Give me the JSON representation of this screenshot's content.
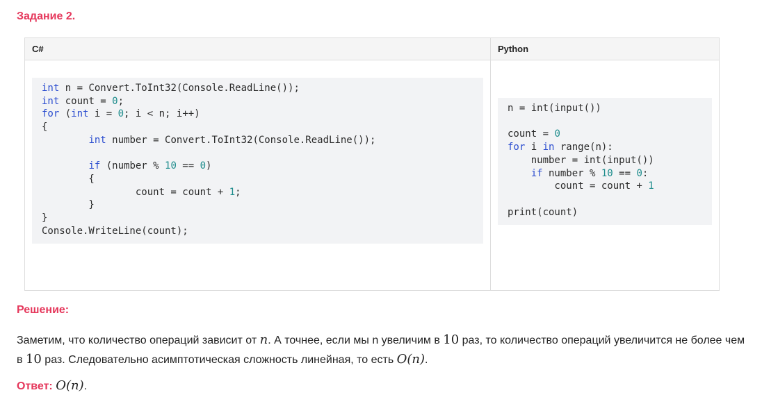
{
  "task_title": "Задание 2.",
  "table": {
    "headers": [
      "C#",
      "Python"
    ],
    "cs_lines": [
      [
        [
          "kw",
          "int"
        ],
        [
          "t",
          " n = Convert.ToInt32(Console.ReadLine());"
        ]
      ],
      [
        [
          "kw",
          "int"
        ],
        [
          "t",
          " count = "
        ],
        [
          "num",
          "0"
        ],
        [
          "t",
          ";"
        ]
      ],
      [
        [
          "kw",
          "for"
        ],
        [
          "t",
          " ("
        ],
        [
          "kw",
          "int"
        ],
        [
          "t",
          " i = "
        ],
        [
          "num",
          "0"
        ],
        [
          "t",
          "; i < n; i++)"
        ]
      ],
      [
        [
          "t",
          "{"
        ]
      ],
      [
        [
          "t",
          "        "
        ],
        [
          "kw",
          "int"
        ],
        [
          "t",
          " number = Convert.ToInt32(Console.ReadLine());"
        ]
      ],
      [
        [
          "t",
          ""
        ]
      ],
      [
        [
          "t",
          "        "
        ],
        [
          "kw",
          "if"
        ],
        [
          "t",
          " (number % "
        ],
        [
          "num",
          "10"
        ],
        [
          "t",
          " == "
        ],
        [
          "num",
          "0"
        ],
        [
          "t",
          ")"
        ]
      ],
      [
        [
          "t",
          "        {"
        ]
      ],
      [
        [
          "t",
          "                count = count + "
        ],
        [
          "num",
          "1"
        ],
        [
          "t",
          ";"
        ]
      ],
      [
        [
          "t",
          "        }"
        ]
      ],
      [
        [
          "t",
          "}"
        ]
      ],
      [
        [
          "t",
          "Console.WriteLine(count);"
        ]
      ]
    ],
    "py_lines": [
      [
        [
          "t",
          "n = int(input())"
        ]
      ],
      [
        [
          "t",
          ""
        ]
      ],
      [
        [
          "t",
          "count = "
        ],
        [
          "num",
          "0"
        ]
      ],
      [
        [
          "kw",
          "for"
        ],
        [
          "t",
          " i "
        ],
        [
          "kw",
          "in"
        ],
        [
          "t",
          " range(n):"
        ]
      ],
      [
        [
          "t",
          "    number = int(input())"
        ]
      ],
      [
        [
          "t",
          "    "
        ],
        [
          "kw",
          "if"
        ],
        [
          "t",
          " number % "
        ],
        [
          "num",
          "10"
        ],
        [
          "t",
          " == "
        ],
        [
          "num",
          "0"
        ],
        [
          "t",
          ":"
        ]
      ],
      [
        [
          "t",
          "        count = count + "
        ],
        [
          "num",
          "1"
        ]
      ],
      [
        [
          "t",
          ""
        ]
      ],
      [
        [
          "t",
          "print(count)"
        ]
      ]
    ]
  },
  "solution_title": "Решение:",
  "solution": {
    "text1": "Заметим, что количество операций зависит от ",
    "math_n": "n",
    "text2": ". А точнее, если мы n увеличим в ",
    "math_10": "10",
    "text3": " раз, то количество операций увеличится не более чем в ",
    "math_10b": "10",
    "text4": " раз. Следовательно асимптотическая сложность линейная, то есть ",
    "math_on": "O(n)",
    "text5": "."
  },
  "answer": {
    "label": "Ответ:",
    "math": "O(n)",
    "end": "."
  },
  "colors": {
    "accent": "#e5375b",
    "code_keyword": "#2a4ccf",
    "code_number": "#1d8c8c",
    "code_bg": "#f2f3f5"
  }
}
